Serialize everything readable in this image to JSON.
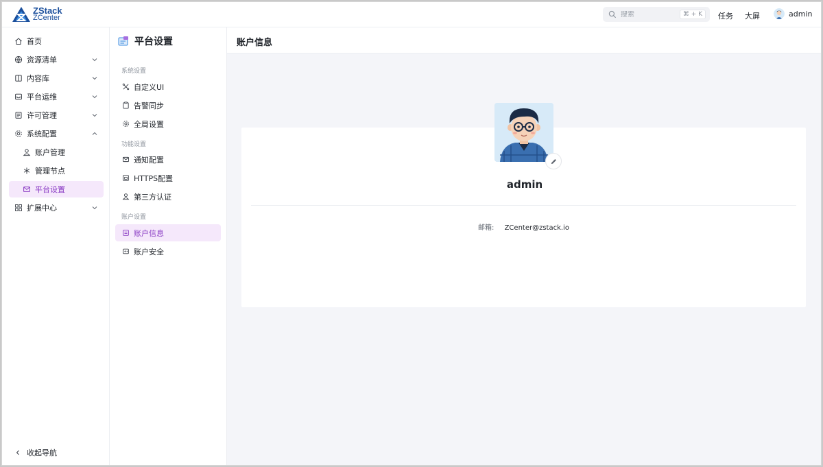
{
  "brand": {
    "line1": "ZStack",
    "line2": "ZCenter"
  },
  "topbar": {
    "search_placeholder": "搜索",
    "search_shortcut": "⌘ + K",
    "tasks": "任务",
    "big_screen": "大屏",
    "user": "admin"
  },
  "nav": {
    "home": "首页",
    "resources": "资源清单",
    "content": "内容库",
    "ops": "平台运维",
    "license": "许可管理",
    "system": "系统配置",
    "account_mgmt": "账户管理",
    "nodes": "管理节点",
    "platform_settings": "平台设置",
    "extensions": "扩展中心",
    "collapse": "收起导航"
  },
  "subnav": {
    "title": "平台设置",
    "group_system": "系统设置",
    "custom_ui": "自定义UI",
    "alarm_sync": "告警同步",
    "global_settings": "全局设置",
    "group_feature": "功能设置",
    "notify": "通知配置",
    "https": "HTTPS配置",
    "third_party": "第三方认证",
    "group_account": "账户设置",
    "account_info": "账户信息",
    "account_security": "账户安全"
  },
  "main": {
    "title": "账户信息",
    "username": "admin",
    "email_label": "邮箱:",
    "email": "ZCenter@zstack.io"
  },
  "colors": {
    "accent": "#8a3cc4",
    "active_bg": "#f5e8fb",
    "brand": "#1b4f9c"
  }
}
